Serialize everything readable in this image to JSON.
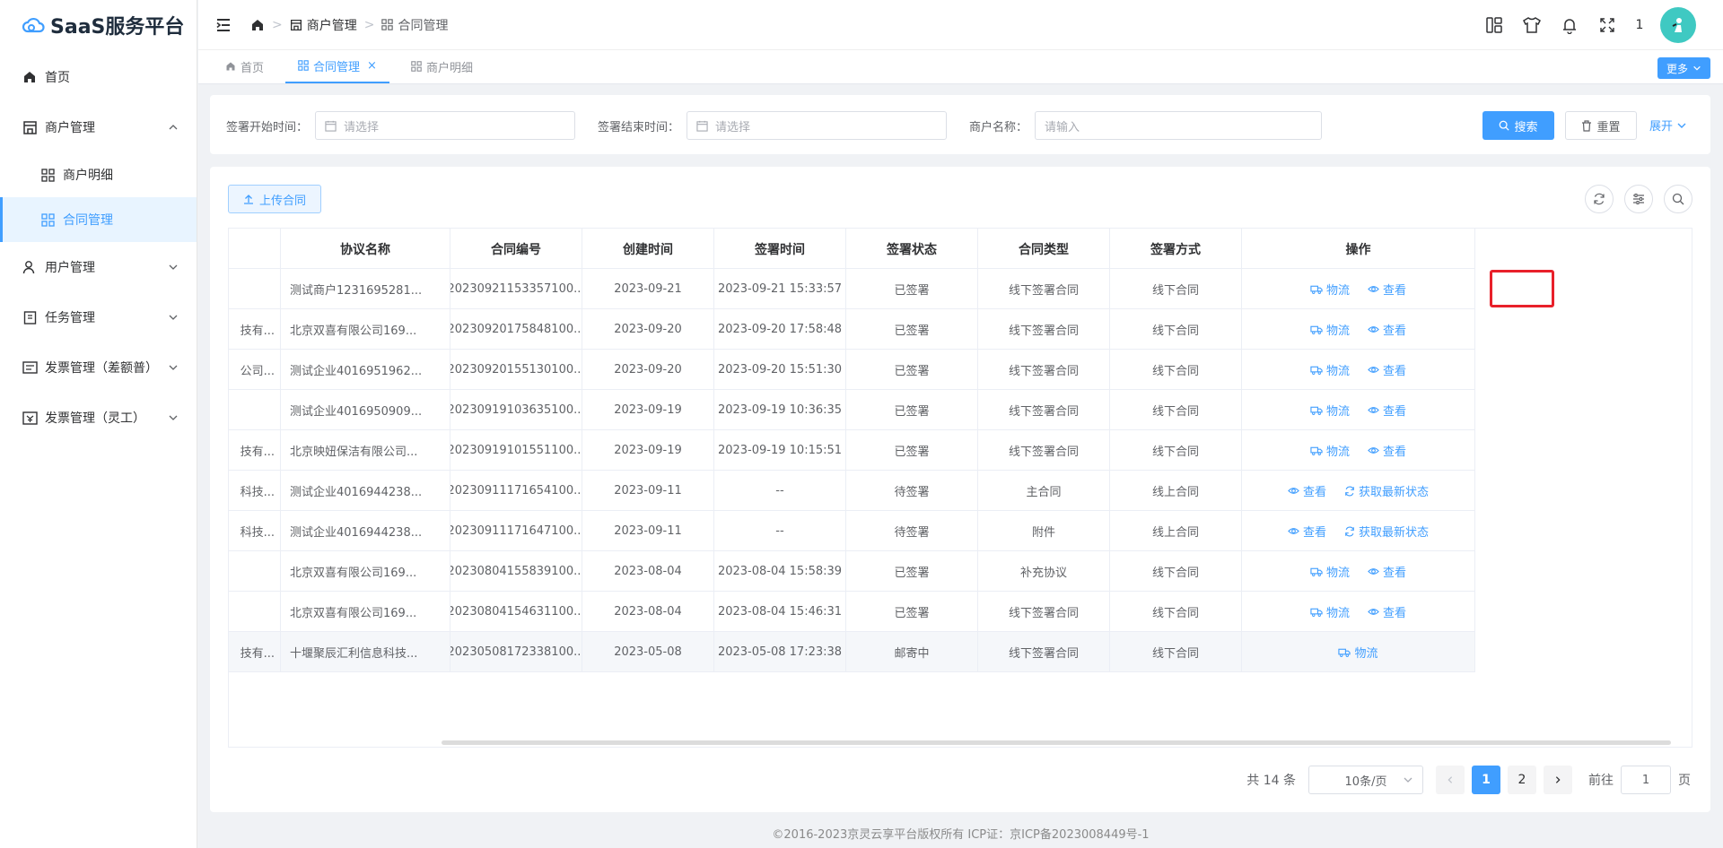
{
  "app": {
    "title": "SaaS服务平台"
  },
  "sidebar": {
    "items": [
      {
        "label": "首页"
      },
      {
        "label": "商户管理"
      },
      {
        "label": "商户明细"
      },
      {
        "label": "合同管理"
      },
      {
        "label": "用户管理"
      },
      {
        "label": "任务管理"
      },
      {
        "label": "发票管理（差额普）"
      },
      {
        "label": "发票管理（灵工）"
      }
    ]
  },
  "header": {
    "breadcrumb": [
      "商户管理",
      "合同管理"
    ],
    "badge_count": "1"
  },
  "tabs": [
    {
      "label": "首页"
    },
    {
      "label": "合同管理"
    },
    {
      "label": "商户明细"
    }
  ],
  "tabs_more": "更多",
  "search": {
    "start_label": "签署开始时间：",
    "start_placeholder": "请选择",
    "end_label": "签署结束时间：",
    "end_placeholder": "请选择",
    "merchant_label": "商户名称：",
    "merchant_placeholder": "请输入",
    "search_btn": "搜索",
    "reset_btn": "重置",
    "expand": "展开"
  },
  "toolbar": {
    "upload": "上传合同"
  },
  "table": {
    "columns": [
      "",
      "协议名称",
      "合同编号",
      "创建时间",
      "签署时间",
      "签署状态",
      "合同类型",
      "签署方式",
      "操作"
    ],
    "rows": [
      {
        "c0": "",
        "name": "测试商户1231695281...",
        "no": "20230921153357100...",
        "created": "2023-09-21",
        "signed": "2023-09-21 15:33:57",
        "status": "已签署",
        "type": "线下签署合同",
        "mode": "线下合同",
        "ops": [
          "物流",
          "查看"
        ]
      },
      {
        "c0": "技有...",
        "name": "北京双喜有限公司169...",
        "no": "20230920175848100...",
        "created": "2023-09-20",
        "signed": "2023-09-20 17:58:48",
        "status": "已签署",
        "type": "线下签署合同",
        "mode": "线下合同",
        "ops": [
          "物流",
          "查看"
        ]
      },
      {
        "c0": "公司...",
        "name": "测试企业4016951962...",
        "no": "20230920155130100...",
        "created": "2023-09-20",
        "signed": "2023-09-20 15:51:30",
        "status": "已签署",
        "type": "线下签署合同",
        "mode": "线下合同",
        "ops": [
          "物流",
          "查看"
        ]
      },
      {
        "c0": "",
        "name": "测试企业4016950909...",
        "no": "20230919103635100...",
        "created": "2023-09-19",
        "signed": "2023-09-19 10:36:35",
        "status": "已签署",
        "type": "线下签署合同",
        "mode": "线下合同",
        "ops": [
          "物流",
          "查看"
        ]
      },
      {
        "c0": "技有...",
        "name": "北京映妞保洁有限公司...",
        "no": "20230919101551100...",
        "created": "2023-09-19",
        "signed": "2023-09-19 10:15:51",
        "status": "已签署",
        "type": "线下签署合同",
        "mode": "线下合同",
        "ops": [
          "物流",
          "查看"
        ]
      },
      {
        "c0": "科技...",
        "name": "测试企业4016944238...",
        "no": "20230911171654100...",
        "created": "2023-09-11",
        "signed": "--",
        "status": "待签署",
        "type": "主合同",
        "mode": "线上合同",
        "ops": [
          "查看",
          "获取最新状态"
        ]
      },
      {
        "c0": "科技...",
        "name": "测试企业4016944238...",
        "no": "20230911171647100...",
        "created": "2023-09-11",
        "signed": "--",
        "status": "待签署",
        "type": "附件",
        "mode": "线上合同",
        "ops": [
          "查看",
          "获取最新状态"
        ]
      },
      {
        "c0": "",
        "name": "北京双喜有限公司169...",
        "no": "20230804155839100...",
        "created": "2023-08-04",
        "signed": "2023-08-04 15:58:39",
        "status": "已签署",
        "type": "补充协议",
        "mode": "线下合同",
        "ops": [
          "物流",
          "查看"
        ]
      },
      {
        "c0": "",
        "name": "北京双喜有限公司169...",
        "no": "20230804154631100...",
        "created": "2023-08-04",
        "signed": "2023-08-04 15:46:31",
        "status": "已签署",
        "type": "线下签署合同",
        "mode": "线下合同",
        "ops": [
          "物流",
          "查看"
        ]
      },
      {
        "c0": "技有...",
        "name": "十堰聚辰汇利信息科技...",
        "no": "20230508172338100...",
        "created": "2023-05-08",
        "signed": "2023-05-08 17:23:38",
        "status": "邮寄中",
        "type": "线下签署合同",
        "mode": "线下合同",
        "ops": [
          "物流"
        ]
      }
    ]
  },
  "pagination": {
    "total": "共 14 条",
    "page_size": "10条/页",
    "pages": [
      "1",
      "2"
    ],
    "goto_label": "前往",
    "goto_value": "1",
    "goto_suffix": "页"
  },
  "footer": "©2016-2023京灵云享平台版权所有 ICP证：京ICP备2023008449号-1",
  "colors": {
    "primary": "#409eff",
    "highlight": "#e8202a",
    "avatar": "#3fc9c2"
  }
}
